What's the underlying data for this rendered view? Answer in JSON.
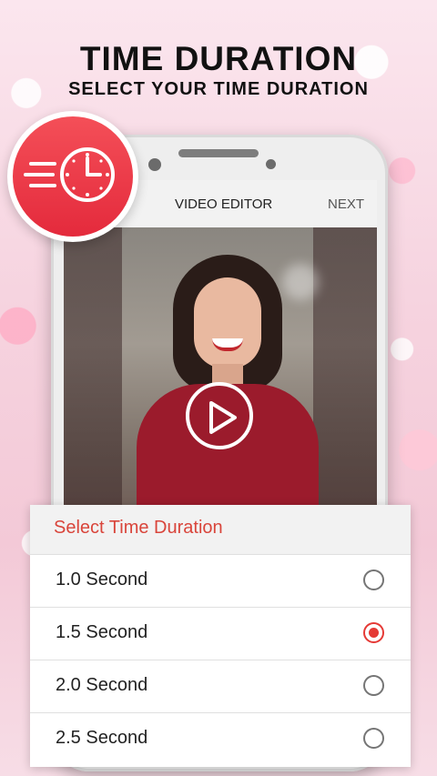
{
  "promo": {
    "headline": "TIME DURATION",
    "subheadline": "SELECT YOUR TIME DURATION"
  },
  "badge_icon": "timer-clock-icon",
  "app": {
    "title": "VIDEO EDITOR",
    "next_label": "NEXT"
  },
  "video": {
    "play_icon": "play-icon"
  },
  "dialog": {
    "title": "Select Time Duration",
    "options": [
      {
        "label": "1.0 Second",
        "selected": false
      },
      {
        "label": "1.5 Second",
        "selected": true
      },
      {
        "label": "2.0 Second",
        "selected": false
      },
      {
        "label": "2.5 Second",
        "selected": false
      }
    ]
  },
  "colors": {
    "accent": "#e53935",
    "dialog_title": "#d9453b",
    "badge_red": "#e42a3c"
  }
}
